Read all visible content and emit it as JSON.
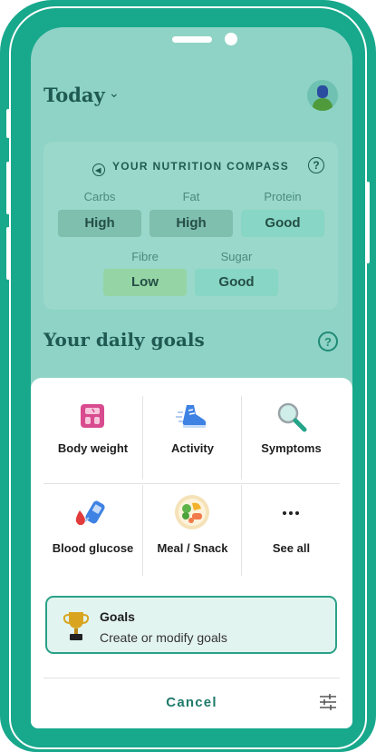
{
  "header": {
    "title": "Today",
    "chevron_icon": "chevron-down-icon",
    "avatar_icon": "user-avatar-icon"
  },
  "compass": {
    "title": "YOUR NUTRITION COMPASS",
    "nutrients": [
      {
        "label": "Carbs",
        "value": "High",
        "color": "#7fbfae"
      },
      {
        "label": "Fat",
        "value": "High",
        "color": "#7fbfae"
      },
      {
        "label": "Protein",
        "value": "Good",
        "color": "#88d6c5"
      },
      {
        "label": "Fibre",
        "value": "Low",
        "color": "#95d5a5"
      },
      {
        "label": "Sugar",
        "value": "Good",
        "color": "#88d6c5"
      }
    ]
  },
  "goals_section": {
    "title": "Your daily goals"
  },
  "sheet": {
    "items": [
      {
        "label": "Body weight",
        "icon": "scale-icon"
      },
      {
        "label": "Activity",
        "icon": "sneaker-icon"
      },
      {
        "label": "Symptoms",
        "icon": "magnifier-icon"
      },
      {
        "label": "Blood glucose",
        "icon": "glucose-meter-icon"
      },
      {
        "label": "Meal / Snack",
        "icon": "meal-plate-icon"
      },
      {
        "label": "See all",
        "icon": "more-dots-icon"
      }
    ],
    "goals": {
      "title": "Goals",
      "subtitle": "Create or modify goals",
      "icon": "trophy-icon"
    },
    "cancel_label": "Cancel",
    "settings_icon": "sliders-icon"
  },
  "colors": {
    "frame": "#18a88c",
    "accent": "#2aa188",
    "text_dark": "#1f5a52"
  }
}
